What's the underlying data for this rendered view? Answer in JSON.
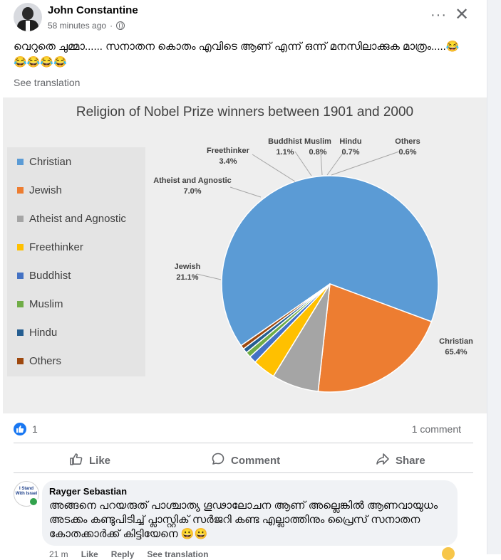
{
  "post": {
    "author": "John Constantine",
    "time": "58 minutes ago",
    "more_label": "···",
    "close_label": "✕",
    "text": "വെറുതെ ചുമ്മാ...... സനാതന കൊതം എവിടെ ആണ് എന്ന് ഒന്ന് മനസിലാക്കുക മാത്രം.....😂😂😂😂😂",
    "see_translation": "See translation"
  },
  "chart_data": {
    "type": "pie",
    "title": "Religion of Nobel Prize winners between 1901 and 2000",
    "legend_position": "left",
    "slices": [
      {
        "name": "Christian",
        "value": 65.4,
        "label": "65.4%",
        "color": "#5b9bd5"
      },
      {
        "name": "Jewish",
        "value": 21.1,
        "label": "21.1%",
        "color": "#ed7d31"
      },
      {
        "name": "Atheist and Agnostic",
        "value": 7.0,
        "label": "7.0%",
        "color": "#a5a5a5"
      },
      {
        "name": "Freethinker",
        "value": 3.4,
        "label": "3.4%",
        "color": "#ffc000"
      },
      {
        "name": "Buddhist",
        "value": 1.1,
        "label": "1.1%",
        "color": "#4472c4"
      },
      {
        "name": "Muslim",
        "value": 0.8,
        "label": "0.8%",
        "color": "#70ad47"
      },
      {
        "name": "Hindu",
        "value": 0.7,
        "label": "0.7%",
        "color": "#255e91"
      },
      {
        "name": "Others",
        "value": 0.6,
        "label": "0.6%",
        "color": "#9e480e"
      }
    ]
  },
  "engagement": {
    "like_count": "1",
    "comment_count": "1 comment"
  },
  "actions": {
    "like": "Like",
    "comment": "Comment",
    "share": "Share"
  },
  "comment": {
    "avatar_text": "I Stand With Israel",
    "name": "Rayger Sebastian",
    "text": "അങ്ങനെ പറയരുത് പാശ്ചാത്യ ഗൂഢാലോചന ആണ് അല്ലെങ്കിൽ ആണവായുധം അടക്കം കണ്ടുപിടിച്ച് പ്ലാസ്റ്റിക് സർജറി കണ്ട എല്ലാത്തിനും പ്രൈസ് സനാതന കോതക്കാർക്ക് കിട്ടിയേനെ 😀😀",
    "time": "21 m",
    "like": "Like",
    "reply": "Reply",
    "see_translation": "See translation"
  }
}
